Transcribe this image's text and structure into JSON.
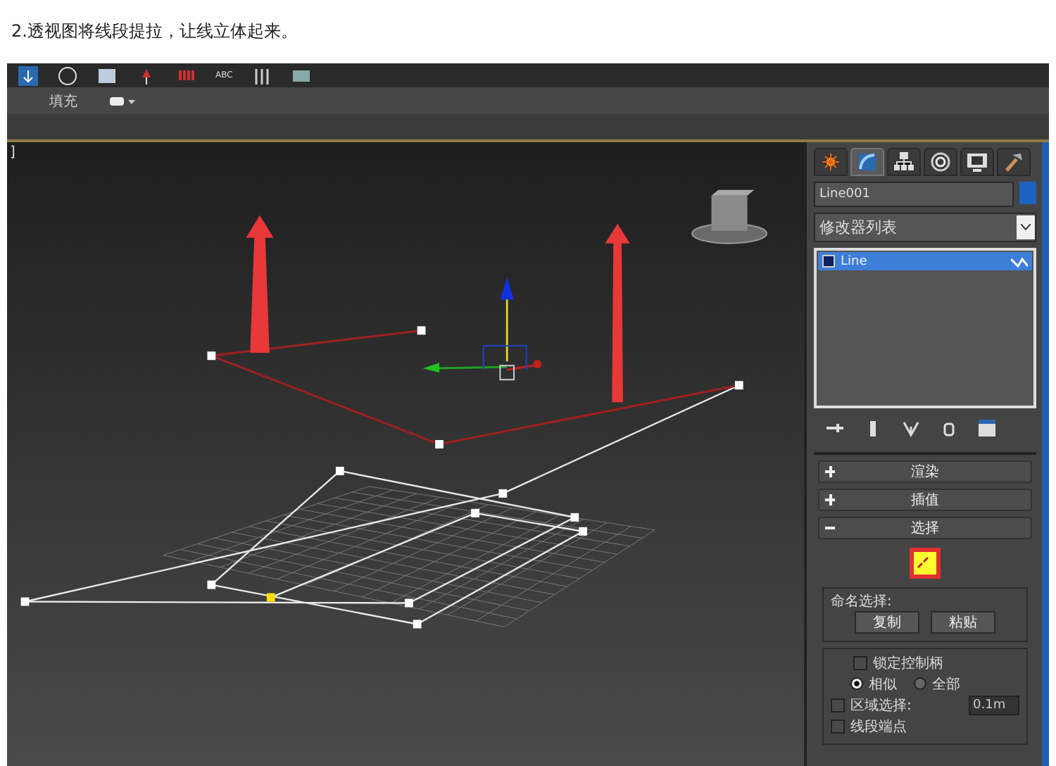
{
  "heading": "2.透视图将线段提拉，让线立体起来。",
  "toolbar": {
    "text": "ABC"
  },
  "ribbon": {
    "label": "填充"
  },
  "viewport": {
    "label": "]"
  },
  "command_tabs": [
    {
      "kind": "create",
      "selected": false
    },
    {
      "kind": "modify",
      "selected": true
    },
    {
      "kind": "hierarchy",
      "selected": false
    },
    {
      "kind": "motion",
      "selected": false
    },
    {
      "kind": "display",
      "selected": false
    },
    {
      "kind": "utilities",
      "selected": false
    }
  ],
  "object_name": {
    "value": "Line001",
    "color": "#1e62c0"
  },
  "modifier_list": {
    "value": "修改器列表"
  },
  "stack": [
    {
      "label": "Line",
      "selected": true
    }
  ],
  "rollouts": [
    {
      "title": "渲染",
      "expanded": false
    },
    {
      "title": "插值",
      "expanded": false
    },
    {
      "title": "选择",
      "expanded": true
    }
  ],
  "selection_levels": [
    {
      "kind": "segment",
      "selected": true
    }
  ],
  "named_selection": {
    "title": "命名选择:",
    "buttons": [
      "复制",
      "粘贴"
    ]
  },
  "lock_handles": {
    "label": "锁定控制柄",
    "checked": false
  },
  "handle_modes": [
    {
      "label": "相似",
      "selected": true
    },
    {
      "label": "全部",
      "selected": false
    }
  ],
  "area_select": {
    "label": "区域选择:",
    "checked": false,
    "value": "0.1m"
  },
  "segment_end": {
    "label": "线段端点",
    "checked": false
  }
}
